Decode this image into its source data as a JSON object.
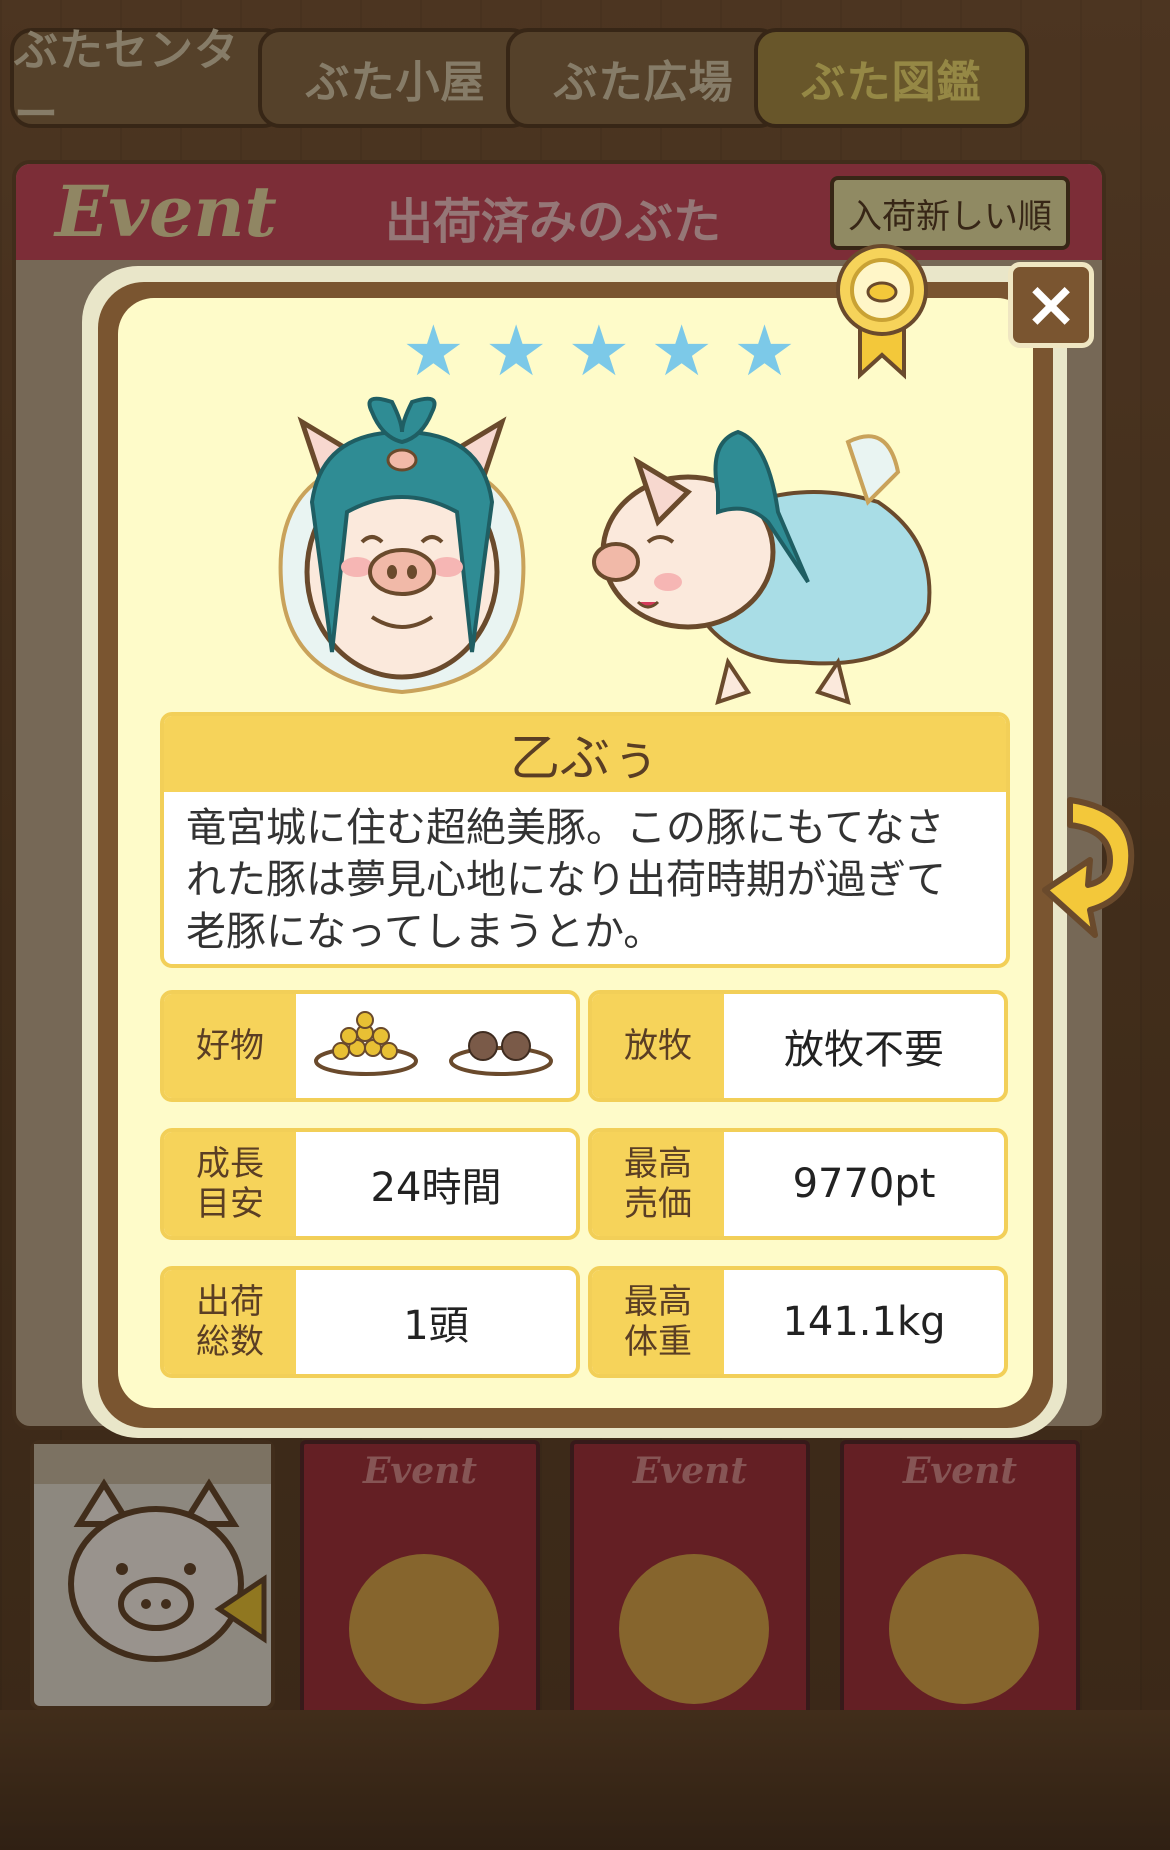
{
  "tabs": [
    {
      "label": "ぶたセンター",
      "active": false
    },
    {
      "label": "ぶた小屋",
      "active": false
    },
    {
      "label": "ぶた広場",
      "active": false
    },
    {
      "label": "ぶた図鑑",
      "active": true
    }
  ],
  "list": {
    "event_logo": "Event",
    "title": "出荷済みのぶた",
    "sort_label": "入荷新しい順"
  },
  "books": [
    {
      "label": "Event"
    },
    {
      "label": "Event"
    },
    {
      "label": "Event"
    }
  ],
  "modal": {
    "close_label": "×",
    "rating": 5,
    "pig_name": "乙ぶぅ",
    "description": "竜宮城に住む超絶美豚。この豚にもてなされた豚は夢見心地になり出荷時期が過ぎて老豚になってしまうとか。",
    "stats": {
      "favorite_key": "好物",
      "favorite_icons": [
        "grain-plate-icon",
        "meatball-plate-icon"
      ],
      "graze_key": "放牧",
      "graze_value": "放牧不要",
      "growth_key_1": "成長",
      "growth_key_2": "目安",
      "growth_value": "24時間",
      "price_key_1": "最高",
      "price_key_2": "売価",
      "price_value": "9770pt",
      "shipped_key_1": "出荷",
      "shipped_key_2": "総数",
      "shipped_value": "1頭",
      "weight_key_1": "最高",
      "weight_key_2": "体重",
      "weight_value": "141.1kg"
    }
  },
  "colors": {
    "card_bg": "#fefbc9",
    "accent_yellow": "#f6d35a",
    "star_blue": "#7cc9e8",
    "frame_brown": "#7a5530"
  }
}
